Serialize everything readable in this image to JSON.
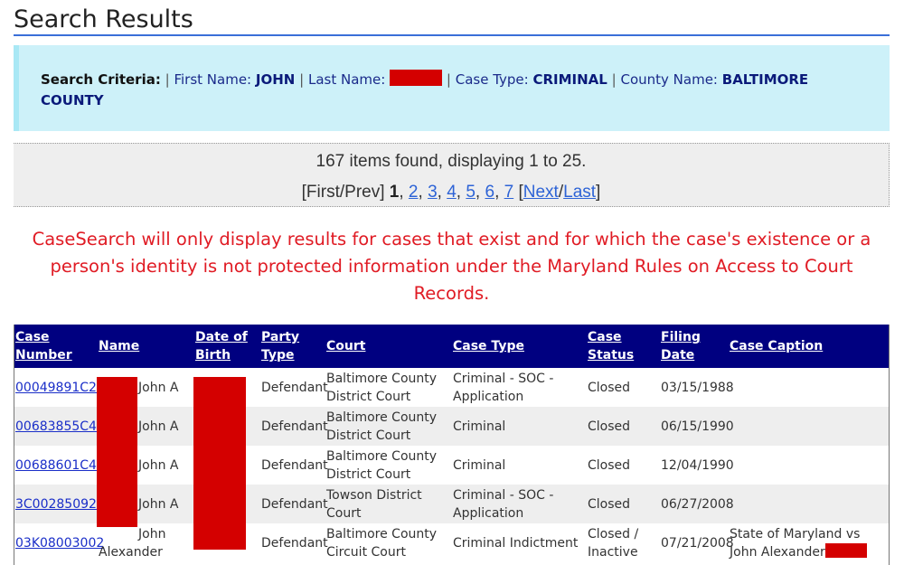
{
  "page": {
    "title": "Search Results"
  },
  "criteria": {
    "heading": "Search Criteria:",
    "separator": "|",
    "fields": [
      {
        "label": "First Name:",
        "value": "JOHN"
      },
      {
        "label": "Last Name:",
        "value": "",
        "redacted": true
      },
      {
        "label": "Case Type:",
        "value": "CRIMINAL"
      },
      {
        "label": "County Name:",
        "value": "BALTIMORE COUNTY"
      }
    ]
  },
  "results": {
    "summary": "167 items found, displaying 1 to 25.",
    "pager": {
      "first_prev": "[First/Prev]",
      "current": "1",
      "pages": [
        "2",
        "3",
        "4",
        "5",
        "6",
        "7"
      ],
      "open_bracket": "[",
      "next": "Next",
      "slash": "/",
      "last": "Last",
      "close_bracket": "]"
    }
  },
  "notice": "CaseSearch will only display results for cases that exist and for which the case's existence or a person's identity is not protected information under the Maryland Rules on Access to Court Records.",
  "colors": {
    "header_bg": "#000080",
    "notice": "#e01b24",
    "criteria_bg": "#cdf1f9",
    "link": "#1a2ec8",
    "redaction": "#d40000"
  },
  "table": {
    "columns": [
      "Case Number",
      "Name",
      "Date of Birth",
      "Party Type",
      "Court",
      "Case Type",
      "Case Status",
      "Filing Date",
      "Case Caption"
    ],
    "rows": [
      {
        "case_number": "00049891C2",
        "name": "John A",
        "dob": "",
        "party_type": "Defendant",
        "court": "Baltimore County District Court",
        "case_type": "Criminal - SOC - Application",
        "case_status": "Closed",
        "filing_date": "03/15/1988",
        "caption": ""
      },
      {
        "case_number": "00683855C4",
        "name": "John A",
        "dob": "",
        "party_type": "Defendant",
        "court": "Baltimore County District Court",
        "case_type": "Criminal",
        "case_status": "Closed",
        "filing_date": "06/15/1990",
        "caption": ""
      },
      {
        "case_number": "00688601C4",
        "name": "John A",
        "dob": "",
        "party_type": "Defendant",
        "court": "Baltimore County District Court",
        "case_type": "Criminal",
        "case_status": "Closed",
        "filing_date": "12/04/1990",
        "caption": ""
      },
      {
        "case_number": "3C00285092",
        "name": "John A",
        "dob": "",
        "party_type": "Defendant",
        "court": "Towson District Court",
        "case_type": "Criminal - SOC - Application",
        "case_status": "Closed",
        "filing_date": "06/27/2008",
        "caption": ""
      },
      {
        "case_number": "03K08003002",
        "name": "John Alexander",
        "dob": "",
        "party_type": "Defendant",
        "court": "Baltimore County Circuit Court",
        "case_type": "Criminal Indictment",
        "case_status": "Closed / Inactive",
        "filing_date": "07/21/2008",
        "caption": "State of Maryland vs John Alexander"
      }
    ]
  }
}
